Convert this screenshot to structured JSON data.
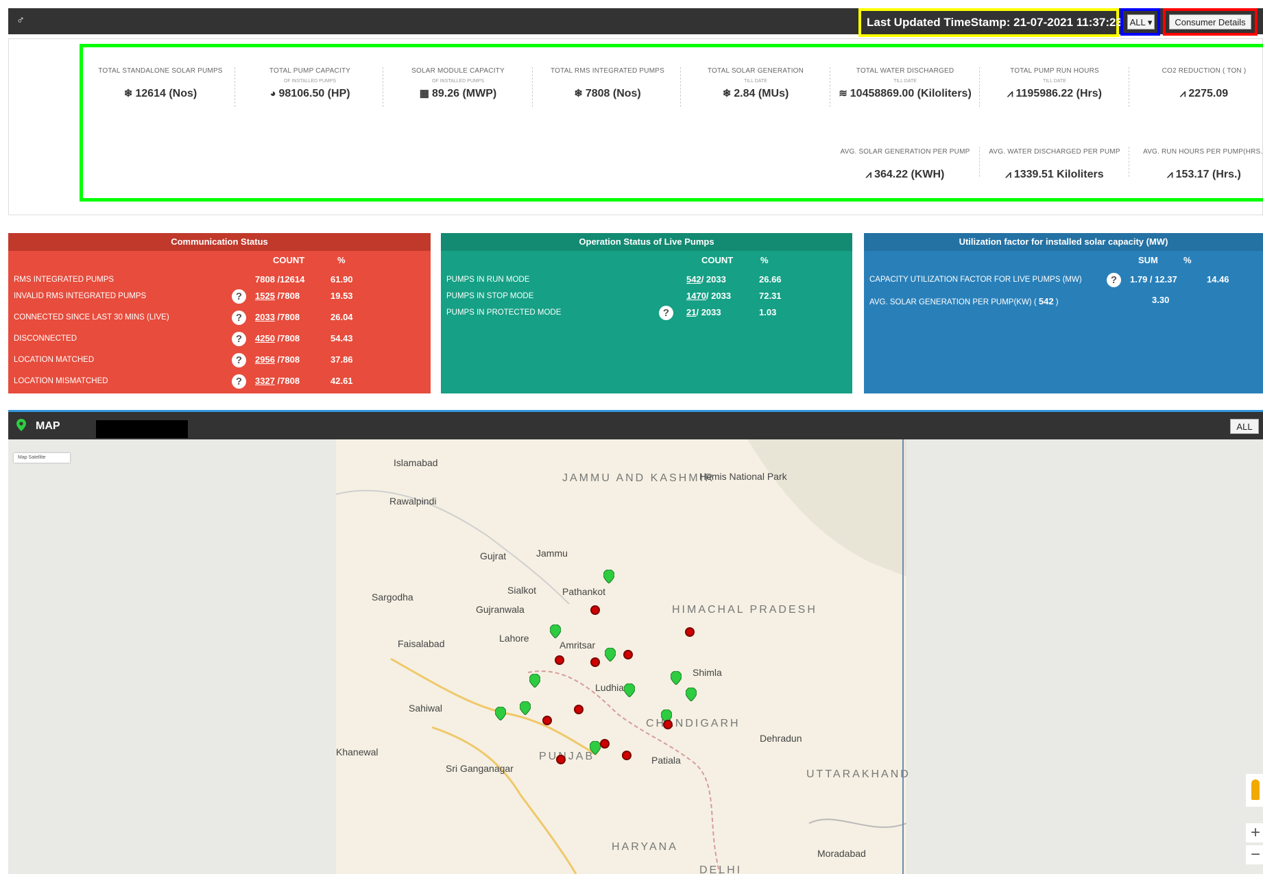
{
  "topbar": {
    "brand_icon": "♂",
    "timestamp_label": "Last Updated TimeStamp: 21-07-2021 11:37:23",
    "filter_label": "ALL ▾",
    "consumer_label": "Consumer Details",
    "minus": "−"
  },
  "kpis": [
    {
      "label": "TOTAL STANDALONE SOLAR PUMPS",
      "sub": "",
      "icon": "sun-icon",
      "glyph": "❄",
      "value": "12614 (Nos)"
    },
    {
      "label": "TOTAL PUMP CAPACITY",
      "sub": "OF INSTALLED PUMPS",
      "icon": "binoculars-icon",
      "glyph": "◕",
      "value": "98106.50 (HP)"
    },
    {
      "label": "SOLAR MODULE CAPACITY",
      "sub": "OF INSTALLED PUMPS",
      "icon": "solar-panel-icon",
      "glyph": "▦",
      "value": "89.26 (MWP)"
    },
    {
      "label": "TOTAL RMS INTEGRATED PUMPS",
      "sub": "",
      "icon": "sun-icon",
      "glyph": "❄",
      "value": "7808 (Nos)"
    },
    {
      "label": "TOTAL SOLAR GENERATION",
      "sub": "TILL DATE",
      "icon": "sun-icon",
      "glyph": "❄",
      "value": "2.84 (MUs)"
    },
    {
      "label": "TOTAL WATER DISCHARGED",
      "sub": "TILL DATE",
      "icon": "water-icon",
      "glyph": "≋",
      "value": "10458869.00 (Kiloliters)"
    },
    {
      "label": "TOTAL PUMP RUN HOURS",
      "sub": "TILL DATE",
      "icon": "line-chart-icon",
      "glyph": "⩘",
      "value": "1195986.22 (Hrs)"
    },
    {
      "label": "CO2 REDUCTION ( TON )",
      "sub": "",
      "icon": "line-chart-icon",
      "glyph": "⩘",
      "value": "2275.09"
    },
    {
      "label": "AVG. SOLAR GENERATION PER PUMP",
      "sub": "",
      "icon": "line-chart-icon",
      "glyph": "⩘",
      "value": "364.22 (KWH)"
    },
    {
      "label": "AVG. WATER DISCHARGED PER PUMP",
      "sub": "",
      "icon": "line-chart-icon",
      "glyph": "⩘",
      "value": "1339.51 Kiloliters"
    },
    {
      "label": "AVG. RUN HOURS PER PUMP(HRS.)",
      "sub": "",
      "icon": "line-chart-icon",
      "glyph": "⩘",
      "value": "153.17 (Hrs.)"
    }
  ],
  "communication": {
    "title": "Communication Status",
    "col_count": "COUNT",
    "col_pct": "%",
    "rows": [
      {
        "label": "RMS INTEGRATED PUMPS",
        "help": false,
        "link": "",
        "count": "7808 /12614",
        "pct": "61.90"
      },
      {
        "label": "INVALID RMS INTEGRATED PUMPS",
        "help": true,
        "link": "1525",
        "count": " /7808",
        "pct": "19.53"
      },
      {
        "label": "CONNECTED SINCE LAST 30 MINS (LIVE)",
        "help": true,
        "link": "2033",
        "count": " /7808",
        "pct": "26.04"
      },
      {
        "label": "DISCONNECTED",
        "help": true,
        "link": "4250",
        "count": " /7808",
        "pct": "54.43"
      },
      {
        "label": "LOCATION MATCHED",
        "help": true,
        "link": "2956",
        "count": " /7808",
        "pct": "37.86"
      },
      {
        "label": "LOCATION MISMATCHED",
        "help": true,
        "link": "3327",
        "count": " /7808",
        "pct": "42.61"
      }
    ]
  },
  "operation": {
    "title": "Operation Status of Live Pumps",
    "col_count": "COUNT",
    "col_pct": "%",
    "rows": [
      {
        "label": "PUMPS IN RUN MODE",
        "help": false,
        "link": "542",
        "count": "/ 2033",
        "pct": "26.66"
      },
      {
        "label": "PUMPS IN STOP MODE",
        "help": false,
        "link": "1470",
        "count": "/ 2033",
        "pct": "72.31"
      },
      {
        "label": "PUMPS IN PROTECTED MODE",
        "help": true,
        "link": "21",
        "count": "/ 2033",
        "pct": "1.03"
      }
    ]
  },
  "utilization": {
    "title": "Utilization factor for installed solar capacity (MW)",
    "col_sum": "SUM",
    "col_pct": "%",
    "rows": [
      {
        "label": "CAPACITY UTILIZATION FACTOR FOR LIVE PUMPS (MW)",
        "help": true,
        "sum": "1.79 / 12.37",
        "pct": "14.46"
      },
      {
        "label": "AVG. SOLAR GENERATION PER PUMP(KW) ( ",
        "label_bold": "542",
        "label_end": " )",
        "help": false,
        "sum": "3.30",
        "pct": ""
      }
    ]
  },
  "map": {
    "title": "MAP",
    "filter_label": "ALL",
    "map_type": "Map   Satellite",
    "zoom_in": "+",
    "zoom_out": "−",
    "labels": [
      {
        "text": "Islamabad",
        "name": "map-label-islamabad"
      },
      {
        "text": "Rawalpindi",
        "name": "map-label-rawalpindi"
      },
      {
        "text": "JAMMU AND KASHMIR",
        "name": "map-label-jammu-kashmir"
      },
      {
        "text": "Hemis National Park",
        "name": "map-label-hemis"
      },
      {
        "text": "Jammu",
        "name": "map-label-jammu"
      },
      {
        "text": "Gujrat",
        "name": "map-label-gujrat"
      },
      {
        "text": "Sialkot",
        "name": "map-label-sialkot"
      },
      {
        "text": "Pathankot",
        "name": "map-label-pathankot"
      },
      {
        "text": "Sargodha",
        "name": "map-label-sargodha"
      },
      {
        "text": "Gujranwala",
        "name": "map-label-gujranwala"
      },
      {
        "text": "HIMACHAL PRADESH",
        "name": "map-label-himachal"
      },
      {
        "text": "Faisalabad",
        "name": "map-label-faisalabad"
      },
      {
        "text": "Lahore",
        "name": "map-label-lahore"
      },
      {
        "text": "Amritsar",
        "name": "map-label-amritsar"
      },
      {
        "text": "Shimla",
        "name": "map-label-shimla"
      },
      {
        "text": "Ludhiana",
        "name": "map-label-ludhiana"
      },
      {
        "text": "Sahiwal",
        "name": "map-label-sahiwal"
      },
      {
        "text": "CHANDIGARH",
        "name": "map-label-chandigarh"
      },
      {
        "text": "Dehradun",
        "name": "map-label-dehradun"
      },
      {
        "text": "Khanewal",
        "name": "map-label-khanewal"
      },
      {
        "text": "PUNJAB",
        "name": "map-label-punjab"
      },
      {
        "text": "Patiala",
        "name": "map-label-patiala"
      },
      {
        "text": "Sri Ganganagar",
        "name": "map-label-sriganganagar"
      },
      {
        "text": "UTTARAKHAND",
        "name": "map-label-uttarakhand"
      },
      {
        "text": "HARYANA",
        "name": "map-label-haryana"
      },
      {
        "text": "Moradabad",
        "name": "map-label-moradabad"
      },
      {
        "text": "DELHI",
        "name": "map-label-delhi"
      }
    ]
  },
  "colors": {
    "topbar": "#333333",
    "red": "#e74c3c",
    "green": "#16a085",
    "blue": "#2980b9",
    "highlight_yellow": "#ffff00",
    "highlight_blue": "#0000ff",
    "highlight_red": "#ff0000",
    "highlight_green": "#00ff00"
  }
}
